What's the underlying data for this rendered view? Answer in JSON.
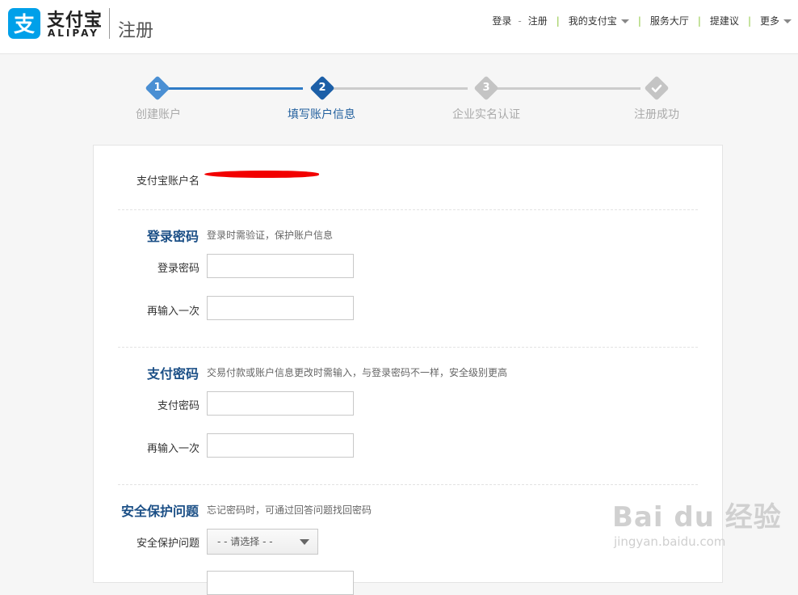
{
  "header": {
    "logo_cn": "支付宝",
    "logo_en": "ALIPAY",
    "page_name": "注册",
    "nav": {
      "login": "登录",
      "register": "注册",
      "my_alipay": "我的支付宝",
      "service_hall": "服务大厅",
      "feedback": "提建议",
      "more": "更多"
    }
  },
  "steps": [
    {
      "num": "1",
      "label": "创建账户"
    },
    {
      "num": "2",
      "label": "填写账户信息"
    },
    {
      "num": "3",
      "label": "企业实名认证"
    },
    {
      "num": "",
      "label": "注册成功"
    }
  ],
  "form": {
    "account_label": "支付宝账户名",
    "login_section": {
      "title": "登录密码",
      "desc": "登录时需验证，保护账户信息",
      "password_label": "登录密码",
      "confirm_label": "再输入一次",
      "password_value": "",
      "confirm_value": ""
    },
    "pay_section": {
      "title": "支付密码",
      "desc": "交易付款或账户信息更改时需输入，与登录密码不一样，安全级别更高",
      "password_label": "支付密码",
      "confirm_label": "再输入一次",
      "password_value": "",
      "confirm_value": ""
    },
    "security_section": {
      "title": "安全保护问题",
      "desc": "忘记密码时，可通过回答问题找回密码",
      "question_label": "安全保护问题",
      "question_selected": "- - 请选择 - -"
    }
  },
  "watermark": {
    "brand": "Bai du 经验",
    "url": "jingyan.baidu.com"
  },
  "colors": {
    "brand_blue": "#00a0e9",
    "step_active": "#2f7bc6",
    "step_inactive": "#c4c4c4",
    "section_title": "#1b4f86",
    "redaction": "#f20000"
  }
}
